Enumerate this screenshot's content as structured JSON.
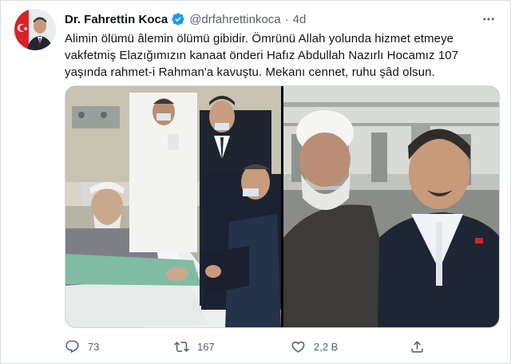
{
  "author": {
    "display_name": "Dr. Fahrettin Koca",
    "handle": "@drfahrettinkoca",
    "separator": "·",
    "time_ago": "4d",
    "verified": true,
    "avatar_icon": "profile-photo-with-turkish-flag"
  },
  "tweet": {
    "lines": [
      "Alimin ölümü âlemin ölümü gibidir. Ömrünü Allah yolunda hizmet etmeye",
      "vakfetmiş Elazığımızın kanaat önderi Hafız Abdullah Nazırlı Hocamız 107",
      "yaşında rahmet-i Rahman'a kavuştu. Mekanı cennet, ruhu şâd olsun."
    ]
  },
  "media": {
    "images": [
      {
        "icon": "hospital-bed-visit-photo"
      },
      {
        "icon": "elderly-man-portrait-photo"
      }
    ]
  },
  "actions": {
    "reply_count": "73",
    "retweet_count": "167",
    "like_count": "2,2 B",
    "share_count": ""
  },
  "colors": {
    "text": "#0f1419",
    "secondary": "#536471",
    "verified": "#1d9bf0",
    "border": "#cfd9de"
  }
}
